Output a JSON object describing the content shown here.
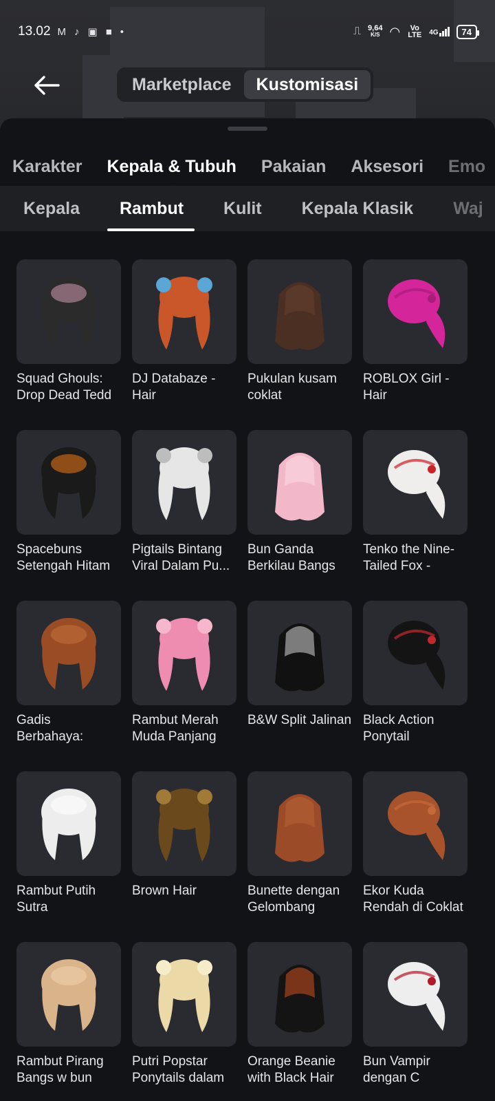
{
  "status_bar": {
    "time": "13.02",
    "notif_icons": [
      "gmail-icon",
      "tiktok-icon",
      "app-icon",
      "square-icon",
      "dot-icon"
    ],
    "net_speed": "9,64",
    "net_unit": "K/S",
    "volte": "Vo LTE",
    "signal": "4G",
    "battery": "74"
  },
  "header": {
    "back_label": "←",
    "segments": [
      {
        "label": "Marketplace",
        "active": false
      },
      {
        "label": "Kustomisasi",
        "active": true
      }
    ]
  },
  "categories": [
    {
      "label": "Karakter",
      "active": false
    },
    {
      "label": "Kepala & Tubuh",
      "active": true
    },
    {
      "label": "Pakaian",
      "active": false
    },
    {
      "label": "Aksesori",
      "active": false
    },
    {
      "label": "Emo",
      "active": false
    }
  ],
  "subcategories": [
    {
      "label": "Kepala",
      "active": false
    },
    {
      "label": "Rambut",
      "active": true
    },
    {
      "label": "Kulit",
      "active": false
    },
    {
      "label": "Kepala Klasik",
      "active": false
    },
    {
      "label": "Waj",
      "active": false
    }
  ],
  "items": [
    {
      "name": "Squad Ghouls: Drop Dead Tedd",
      "color": "#2b2b2b",
      "accent": "#d19ab0"
    },
    {
      "name": "DJ Databaze - Hair",
      "color": "#c9572a",
      "accent": "#5aa6d6"
    },
    {
      "name": "Pukulan kusam coklat",
      "color": "#4a2f22",
      "accent": "#6b4331"
    },
    {
      "name": "ROBLOX Girl - Hair",
      "color": "#d4269a",
      "accent": "#a81c7a"
    },
    {
      "name": "Spacebuns Setengah Hitam",
      "color": "#1a1a1a",
      "accent": "#f07a16"
    },
    {
      "name": "Pigtails Bintang Viral Dalam Pu...",
      "color": "#e6e6e6",
      "accent": "#bdbdbd"
    },
    {
      "name": "Bun Ganda Berkilau Bangs",
      "color": "#f2b7c8",
      "accent": "#fbe1e8"
    },
    {
      "name": "Tenko the Nine-Tailed Fox -",
      "color": "#f0eded",
      "accent": "#c8242a"
    },
    {
      "name": "Gadis Berbahaya: Coklat",
      "color": "#9a4d24",
      "accent": "#c2713c"
    },
    {
      "name": "Rambut Merah Muda Panjang",
      "color": "#ee8db0",
      "accent": "#f6b6cc"
    },
    {
      "name": "B&W Split Jalinan",
      "color": "#111111",
      "accent": "#e8e8e8"
    },
    {
      "name": "Black Action Ponytail",
      "color": "#141414",
      "accent": "#c0292e"
    },
    {
      "name": "Rambut Putih Sutra",
      "color": "#ededed",
      "accent": "#ffffff"
    },
    {
      "name": "Brown Hair",
      "color": "#6a4a1c",
      "accent": "#a07a36"
    },
    {
      "name": "Bunette dengan Gelombang",
      "color": "#9b4b27",
      "accent": "#b9653a"
    },
    {
      "name": "Ekor Kuda Rendah di Coklat",
      "color": "#a8532b",
      "accent": "#c46a3a"
    },
    {
      "name": "Rambut Pirang Bangs w bun",
      "color": "#d9b48b",
      "accent": "#f0d2ad"
    },
    {
      "name": "Putri Popstar Ponytails dalam",
      "color": "#ecd9a8",
      "accent": "#f7ecc9"
    },
    {
      "name": "Orange Beanie with Black Hair",
      "color": "#141414",
      "accent": "#e0541d"
    },
    {
      "name": "Bun Vampir dengan C",
      "color": "#eeeeee",
      "accent": "#b3182a"
    }
  ]
}
